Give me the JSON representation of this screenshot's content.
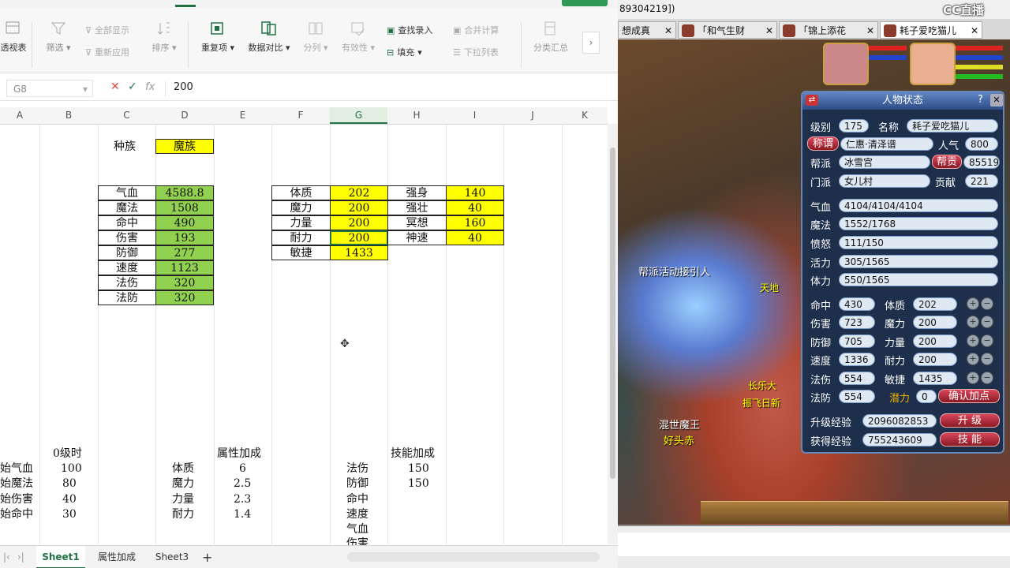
{
  "ribbon": {
    "pivot_label": "透视表",
    "filter_label": "筛选",
    "show_all_label": "全部显示",
    "reapply_label": "重新应用",
    "sort_label": "排序",
    "duplicates_label": "重复项",
    "compare_label": "数据对比",
    "split_label": "分列",
    "validity_label": "有效性",
    "find_entry_label": "查找录入",
    "fill_label": "填充",
    "merge_calc_label": "合并计算",
    "dropdown_list_label": "下拉列表",
    "subtotal_label": "分类汇总"
  },
  "formula_bar": {
    "cell_ref": "G8",
    "fx": "fx",
    "value": "200"
  },
  "columns": [
    "A",
    "B",
    "C",
    "D",
    "E",
    "F",
    "G",
    "H",
    "I",
    "J",
    "K"
  ],
  "sheet": {
    "race_label": "种族",
    "race_value": "魔族",
    "table1": [
      {
        "label": "气血",
        "value": "4588.8"
      },
      {
        "label": "魔法",
        "value": "1508"
      },
      {
        "label": "命中",
        "value": "490"
      },
      {
        "label": "伤害",
        "value": "193"
      },
      {
        "label": "防御",
        "value": "277"
      },
      {
        "label": "速度",
        "value": "1123"
      },
      {
        "label": "法伤",
        "value": "320"
      },
      {
        "label": "法防",
        "value": "320"
      }
    ],
    "table2": [
      {
        "label": "体质",
        "value": "202"
      },
      {
        "label": "魔力",
        "value": "200"
      },
      {
        "label": "力量",
        "value": "200"
      },
      {
        "label": "耐力",
        "value": "200"
      },
      {
        "label": "敏捷",
        "value": "1433"
      }
    ],
    "table3": [
      {
        "label": "强身",
        "value": "140"
      },
      {
        "label": "强壮",
        "value": "40"
      },
      {
        "label": "冥想",
        "value": "160"
      },
      {
        "label": "神速",
        "value": "40"
      }
    ],
    "level0_title": "0级时",
    "level0": [
      {
        "label": "始气血",
        "value": "100"
      },
      {
        "label": "始魔法",
        "value": "80"
      },
      {
        "label": "始伤害",
        "value": "40"
      },
      {
        "label": "始命中",
        "value": "30"
      }
    ],
    "attr_title": "属性加成",
    "attr": [
      {
        "label": "体质",
        "value": "6"
      },
      {
        "label": "魔力",
        "value": "2.5"
      },
      {
        "label": "力量",
        "value": "2.3"
      },
      {
        "label": "耐力",
        "value": "1.4"
      }
    ],
    "skill_title": "技能加成",
    "skill": [
      {
        "label": "法伤",
        "value": "150"
      },
      {
        "label": "防御",
        "value": "150"
      },
      {
        "label": "命中",
        "value": ""
      },
      {
        "label": "速度",
        "value": ""
      },
      {
        "label": "气血",
        "value": ""
      },
      {
        "label": "伤害",
        "value": ""
      }
    ]
  },
  "sheet_tabs": [
    "Sheet1",
    "属性加成",
    "Sheet3"
  ],
  "game": {
    "title_text": "89304219])",
    "logo": "CC直播",
    "tabs": [
      "想成真",
      "「和气生财",
      "「锦上添花",
      "耗子爱吃猫儿"
    ],
    "panel": {
      "title": "人物状态",
      "level_label": "级别",
      "level": "175",
      "name_label": "名称",
      "name": "耗子爱吃猫儿",
      "title_btn": "称谓",
      "honor": "仁惠·清泽谱",
      "pop_label": "人气",
      "pop": "800",
      "gang_label": "帮派",
      "gang": "冰雪宫",
      "gang_btn": "帮贡",
      "gang_contrib": "85519",
      "school_label": "门派",
      "school": "女儿村",
      "contrib_label": "贡献",
      "contrib": "221",
      "hp_label": "气血",
      "hp": "4104/4104/4104",
      "mp_label": "魔法",
      "mp": "1552/1768",
      "anger_label": "愤怒",
      "anger": "111/150",
      "vigor_label": "活力",
      "vigor": "305/1565",
      "stamina_label": "体力",
      "stamina": "550/1565",
      "stats_left": [
        {
          "label": "命中",
          "value": "430"
        },
        {
          "label": "伤害",
          "value": "723"
        },
        {
          "label": "防御",
          "value": "705"
        },
        {
          "label": "速度",
          "value": "1336"
        },
        {
          "label": "法伤",
          "value": "554"
        },
        {
          "label": "法防",
          "value": "554"
        }
      ],
      "stats_right": [
        {
          "label": "体质",
          "value": "202"
        },
        {
          "label": "魔力",
          "value": "200"
        },
        {
          "label": "力量",
          "value": "200"
        },
        {
          "label": "耐力",
          "value": "200"
        },
        {
          "label": "敏捷",
          "value": "1435"
        }
      ],
      "potential_label": "潜力",
      "potential": "0",
      "confirm_btn": "确认加点",
      "upgrade_exp_label": "升级经验",
      "upgrade_exp": "2096082853",
      "upgrade_btn": "升 级",
      "gain_exp_label": "获得经验",
      "gain_exp": "755243609",
      "skill_btn": "技 能"
    },
    "scene_texts": [
      "帮派活动接引人",
      "天地",
      "长乐大",
      "振飞日新",
      "混世魔王",
      "好头赤"
    ]
  },
  "colors": {
    "yellow": "#ffff00",
    "green": "#92d050",
    "excel_green": "#217346"
  }
}
